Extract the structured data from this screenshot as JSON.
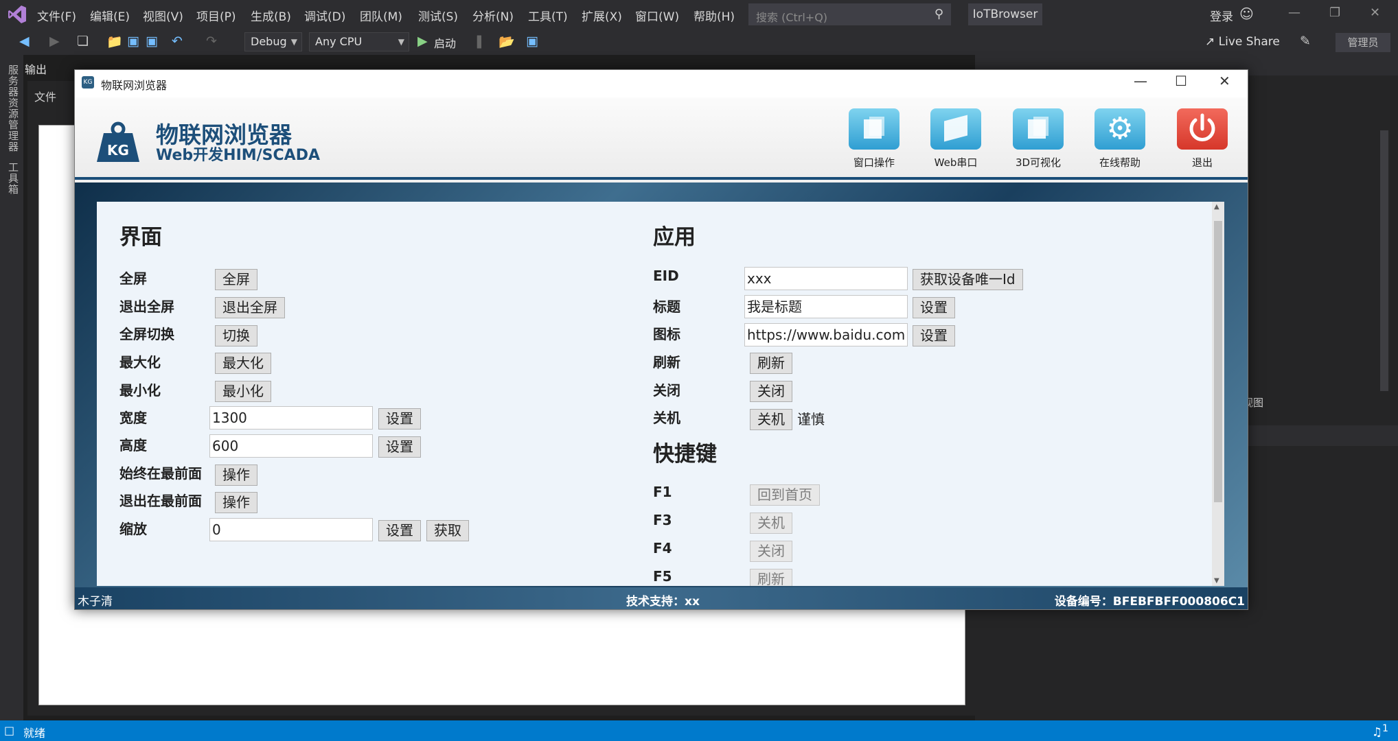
{
  "vs": {
    "menu": [
      "文件(F)",
      "编辑(E)",
      "视图(V)",
      "项目(P)",
      "生成(B)",
      "调试(D)",
      "团队(M)",
      "测试(S)",
      "分析(N)",
      "工具(T)",
      "扩展(X)",
      "窗口(W)",
      "帮助(H)"
    ],
    "search_placeholder": "搜索 (Ctrl+Q)",
    "solution_name": "IoTBrowser",
    "login": "登录",
    "config": "Debug",
    "platform": "Any CPU",
    "run_label": "启动",
    "live_share": "Live Share",
    "admin": "管理员",
    "side_labels": [
      "服务器资源管理器",
      "工具箱"
    ],
    "output_tab": "输出",
    "file_tab": "文件",
    "view_label": "视图",
    "status": "就绪",
    "notification_count": "1"
  },
  "iot": {
    "window_title": "物联网浏览器",
    "logo_text": "KG",
    "brand_title": "物联网浏览器",
    "brand_subtitle": "Web开发HIM/SCADA",
    "header_buttons": [
      "窗口操作",
      "Web串口",
      "3D可视化",
      "在线帮助",
      "退出"
    ],
    "ui_section": {
      "title": "界面",
      "fullscreen": {
        "label": "全屏",
        "button": "全屏"
      },
      "exit_fullscreen": {
        "label": "退出全屏",
        "button": "退出全屏"
      },
      "toggle_fullscreen": {
        "label": "全屏切换",
        "button": "切换"
      },
      "maximize": {
        "label": "最大化",
        "button": "最大化"
      },
      "minimize": {
        "label": "最小化",
        "button": "最小化"
      },
      "width": {
        "label": "宽度",
        "value": "1300",
        "button": "设置"
      },
      "height": {
        "label": "高度",
        "value": "600",
        "button": "设置"
      },
      "topmost": {
        "label": "始终在最前面",
        "button": "操作"
      },
      "exit_topmost": {
        "label": "退出在最前面",
        "button": "操作"
      },
      "zoom": {
        "label": "缩放",
        "value": "0",
        "set_button": "设置",
        "get_button": "获取"
      }
    },
    "app_section": {
      "title": "应用",
      "eid": {
        "label": "EID",
        "value": "xxx",
        "button": "获取设备唯一Id"
      },
      "title_row": {
        "label": "标题",
        "value": "我是标题",
        "button": "设置"
      },
      "icon": {
        "label": "图标",
        "value": "https://www.baidu.com",
        "button": "设置"
      },
      "refresh": {
        "label": "刷新",
        "button": "刷新"
      },
      "close": {
        "label": "关闭",
        "button": "关闭"
      },
      "shutdown": {
        "label": "关机",
        "button": "关机",
        "note": "谨慎"
      }
    },
    "shortcut_section": {
      "title": "快捷键",
      "items": [
        {
          "key": "F1",
          "action": "回到首页"
        },
        {
          "key": "F3",
          "action": "关机"
        },
        {
          "key": "F4",
          "action": "关闭"
        },
        {
          "key": "F5",
          "action": "刷新"
        }
      ]
    },
    "footer": {
      "left": "木子清",
      "mid": "技术支持：xx",
      "right": "设备编号：BFEBFBFF000806C1"
    }
  }
}
